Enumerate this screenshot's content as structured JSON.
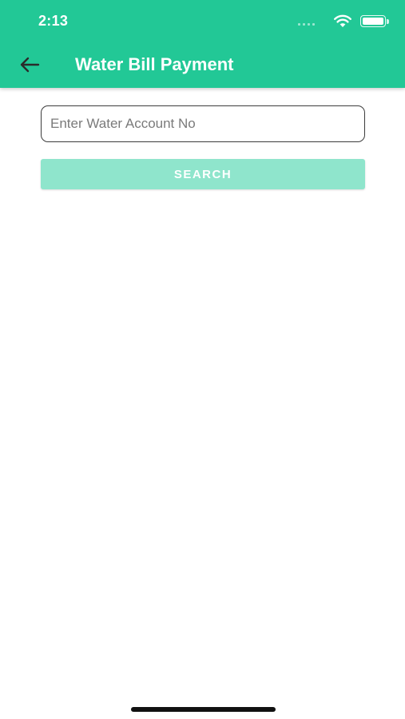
{
  "status_bar": {
    "time": "2:13",
    "icons": [
      "cellular-signal-icon",
      "wifi-icon",
      "battery-icon"
    ]
  },
  "header": {
    "title": "Water Bill Payment",
    "back_icon": "arrow-left-icon",
    "background_color": "#22c896"
  },
  "form": {
    "account_input": {
      "placeholder": "Enter Water Account No",
      "value": ""
    },
    "search_button": {
      "label": "SEARCH",
      "color": "#8fe5cc"
    }
  }
}
